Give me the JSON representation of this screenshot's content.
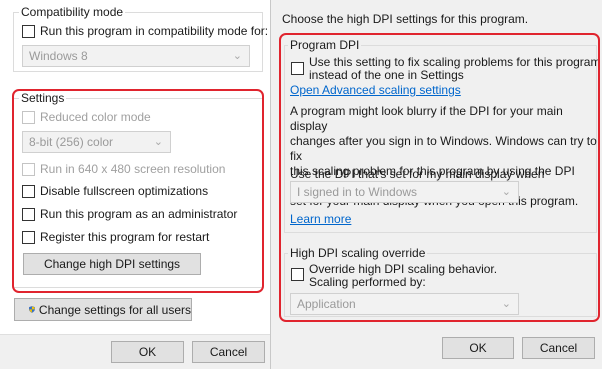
{
  "left": {
    "compat_group_title": "Compatibility mode",
    "compat_checkbox_label": "Run this program in compatibility mode for:",
    "compat_select_value": "Windows 8",
    "settings_group_title": "Settings",
    "reduced_color_label": "Reduced color mode",
    "color_select_value": "8-bit (256) color",
    "run_640_label": "Run in 640 x 480 screen resolution",
    "disable_fullscreen_label": "Disable fullscreen optimizations",
    "run_admin_label": "Run this program as an administrator",
    "register_restart_label": "Register this program for restart",
    "change_dpi_button": "Change high DPI settings",
    "change_all_users_button": "Change settings for all users",
    "ok_button": "OK",
    "cancel_button": "Cancel"
  },
  "right": {
    "heading": "Choose the high DPI settings for this program.",
    "program_dpi_title": "Program DPI",
    "use_setting_line1": "Use this setting to fix scaling problems for this program",
    "use_setting_line2": "instead of the one in Settings",
    "open_advanced_link": "Open Advanced scaling settings",
    "para_line1": "A program might look blurry if the DPI for your main display",
    "para_line2": "changes after you sign in to Windows. Windows can try to fix",
    "para_line3": "this scaling problem for this program by using the DPI that's",
    "para_line4": "set for your main display when you open this program.",
    "use_dpi_label": "Use the DPI that's set for my main display when",
    "signed_in_select": "I signed in to Windows",
    "learn_more_link": "Learn more",
    "override_title": "High DPI scaling override",
    "override_line1": "Override high DPI scaling behavior.",
    "override_line2": "Scaling performed by:",
    "application_select": "Application",
    "ok_button": "OK",
    "cancel_button": "Cancel"
  },
  "colors": {
    "highlight": "#e0242e",
    "link": "#0066cc",
    "disabled_text": "#a0a0a0"
  },
  "icons": {
    "shield": "uac-shield-icon",
    "chevron": "chevron-down-icon"
  }
}
